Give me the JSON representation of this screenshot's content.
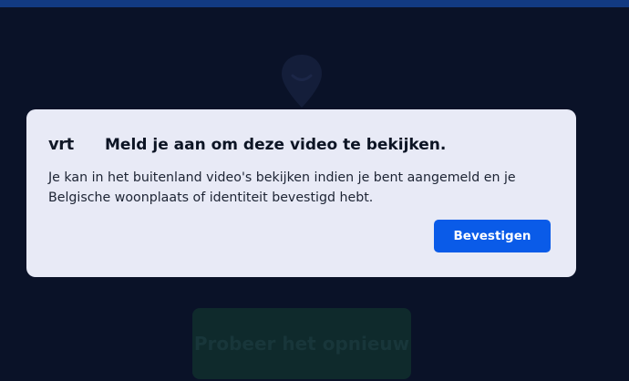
{
  "modal": {
    "logo": "vrt",
    "title": "Meld je aan om deze video te bekijken.",
    "body": "Je kan in het buitenland video's bekijken indien je bent aangemeld en je Belgische woonplaats of identiteit bevestigd hebt.",
    "confirm_label": "Bevestigen"
  },
  "background": {
    "retry_label": "Probeer het opnieuw",
    "icon": "location-pin-icon"
  },
  "colors": {
    "page_background": "#0a1228",
    "top_bar": "#123a82",
    "modal_background": "#e8eaf6",
    "accent": "#0a5be8"
  }
}
